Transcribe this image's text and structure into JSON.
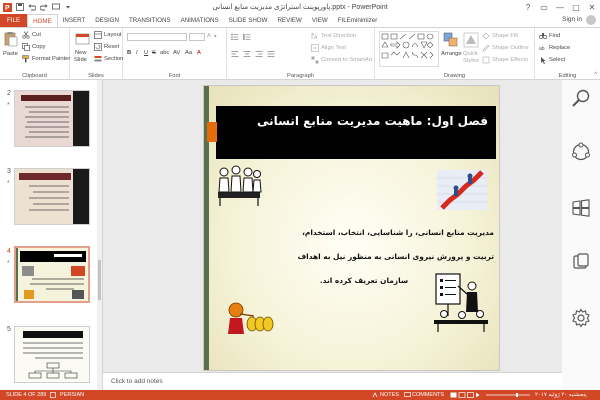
{
  "window": {
    "title": "پاورپوینت استراتژی مدیریت منابع انسانی.pptx - PowerPoint",
    "controls": [
      "?",
      "▭",
      "—",
      "▢",
      "✕"
    ]
  },
  "tabs": {
    "file": "FILE",
    "items": [
      "HOME",
      "INSERT",
      "DESIGN",
      "TRANSITIONS",
      "ANIMATIONS",
      "SLIDE SHOW",
      "REVIEW",
      "VIEW",
      "FILEminimizer"
    ],
    "active": "HOME",
    "signin": "Sign in"
  },
  "ribbon": {
    "clipboard": {
      "paste": "Paste",
      "cut": "Cut",
      "copy": "Copy",
      "format_painter": "Format Painter",
      "label": "Clipboard"
    },
    "slides": {
      "new_slide": "New",
      "new_slide2": "Slide",
      "layout": "Layout",
      "reset": "Reset",
      "section": "Section",
      "label": "Slides"
    },
    "font": {
      "label": "Font",
      "buttons": [
        "B",
        "I",
        "U",
        "S",
        "abc",
        "AV",
        "Aa",
        "A"
      ]
    },
    "paragraph": {
      "text_direction": "Text Direction",
      "align_text": "Align Text",
      "convert": "Convert to SmartArt",
      "label": "Paragraph"
    },
    "drawing": {
      "arrange": "Arrange",
      "quick_styles": "Quick",
      "quick_styles2": "Styles",
      "shape_fill": "Shape Fill",
      "shape_outline": "Shape Outline",
      "shape_effects": "Shape Effects",
      "label": "Drawing"
    },
    "editing": {
      "find": "Find",
      "replace": "Replace",
      "select": "Select",
      "label": "Editing"
    }
  },
  "thumbnails": [
    {
      "num": "2",
      "star": "*"
    },
    {
      "num": "3",
      "star": "*"
    },
    {
      "num": "4",
      "star": "*",
      "selected": true
    },
    {
      "num": "5",
      "star": ""
    }
  ],
  "slide": {
    "title": "فصل اول: ماهیت مدیریت منابع انسانی",
    "lines": [
      "مدیریت منابع انسانی، را شناسایی، انتخاب، استخدام،",
      "تربیت و پرورش نیروی انسانی به منظور نیل به اهداف",
      "سازمان تعریف کرده اند."
    ]
  },
  "notes": {
    "placeholder": "Click to add notes"
  },
  "status": {
    "slide": "SLIDE 4 OF 289",
    "language": "PERSIAN",
    "notes": "NOTES",
    "comments": "COMMENTS",
    "date": "پنجشنبه ۲۰ ژوئیه ۲۰۱۷"
  },
  "colors": {
    "accent": "#d24726",
    "title_box": "#000000",
    "slide_bar": "#5a6f4e",
    "slide_orange": "#e46c0a"
  }
}
